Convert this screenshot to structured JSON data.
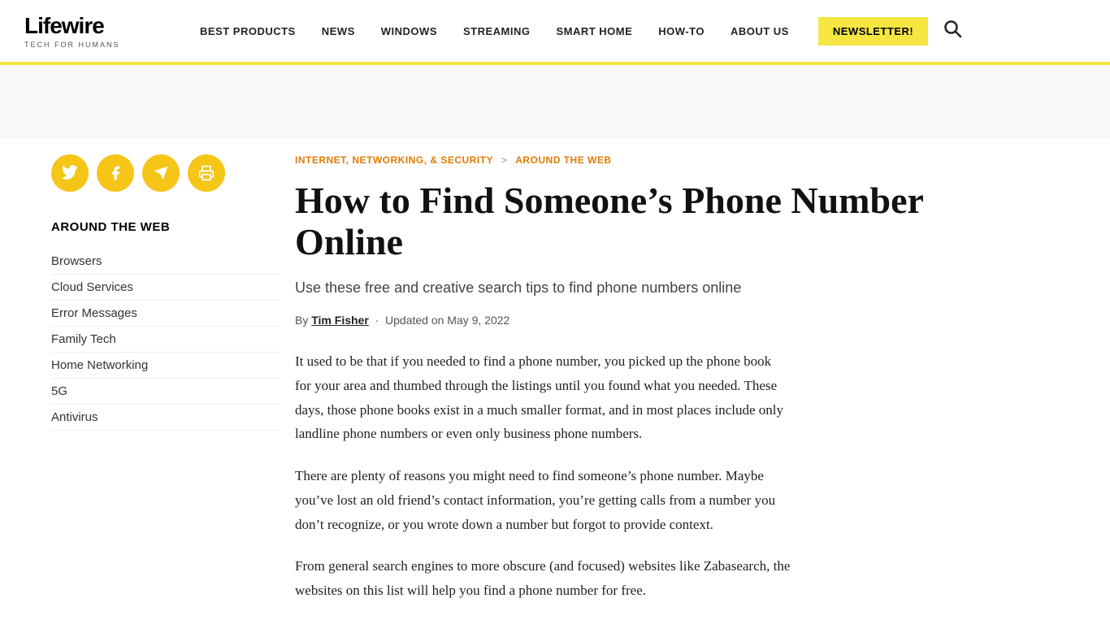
{
  "header": {
    "logo": "Lifewire",
    "tagline": "TECH FOR HUMANS",
    "nav": [
      {
        "label": "BEST PRODUCTS",
        "id": "best-products"
      },
      {
        "label": "NEWS",
        "id": "news"
      },
      {
        "label": "WINDOWS",
        "id": "windows"
      },
      {
        "label": "STREAMING",
        "id": "streaming"
      },
      {
        "label": "SMART HOME",
        "id": "smart-home"
      },
      {
        "label": "HOW-TO",
        "id": "how-to"
      },
      {
        "label": "ABOUT US",
        "id": "about-us"
      }
    ],
    "newsletter_btn": "NEWSLETTER!",
    "search_aria": "Search"
  },
  "breadcrumb": {
    "parent": "INTERNET, NETWORKING, & SECURITY",
    "separator": ">",
    "current": "AROUND THE WEB"
  },
  "article": {
    "title": "How to Find Someone’s Phone Number Online",
    "subtitle": "Use these free and creative search tips to find phone numbers online",
    "author_label": "By",
    "author": "Tim Fisher",
    "date_label": "Updated on May 9, 2022",
    "body_p1": "It used to be that if you needed to find a phone number, you picked up the phone book for your area and thumbed through the listings until you found what you needed. These days, those phone books exist in a much smaller format, and in most places include only landline phone numbers or even only business phone numbers.",
    "body_p2": "There are plenty of reasons you might need to find someone’s phone number. Maybe you’ve lost an old friend’s contact information, you’re getting calls from a number you don’t recognize, or you wrote down a number but forgot to provide context.",
    "body_p3": "From general search engines to more obscure (and focused) websites like Zabasearch, the websites on this list will help you find a phone number for free."
  },
  "share": {
    "twitter_icon": "ᵔ",
    "facebook_icon": "f",
    "telegram_icon": "➤",
    "print_icon": "⎙"
  },
  "sidebar": {
    "section_title": "AROUND THE WEB",
    "links": [
      {
        "label": "Browsers"
      },
      {
        "label": "Cloud Services"
      },
      {
        "label": "Error Messages"
      },
      {
        "label": "Family Tech"
      },
      {
        "label": "Home Networking"
      },
      {
        "label": "5G"
      },
      {
        "label": "Antivirus"
      }
    ]
  }
}
